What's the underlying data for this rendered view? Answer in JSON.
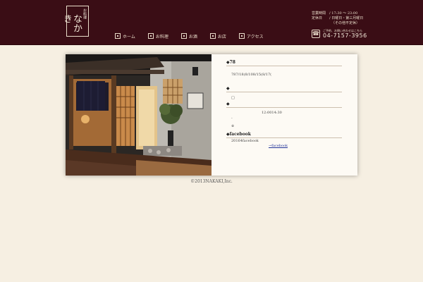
{
  "header": {
    "logo": {
      "main": "なかき",
      "sub": "お料理"
    },
    "nav": [
      {
        "label": "ホーム",
        "icon": "home-icon"
      },
      {
        "label": "お料理",
        "icon": "dish-icon"
      },
      {
        "label": "お酒",
        "icon": "sake-icon"
      },
      {
        "label": "お店",
        "icon": "shop-icon"
      },
      {
        "label": "アクセス",
        "icon": "map-icon"
      }
    ],
    "hours": {
      "line1": "営業時間　/ 17:30 〜 23:00",
      "line2": "定休日　　/ 日曜日・第三月曜日",
      "line3": "（その他不定休）"
    },
    "phone": {
      "note": "ご予約、お問い合わせはこちら",
      "number": "04-7157-3956",
      "icon": "phone-icon"
    }
  },
  "info": {
    "heading1": "◆78",
    "line1": "787/18(8/108/15(8/17(",
    "heading2": "◆",
    "line2": "□",
    "heading3": "◆",
    "line3": "12:0014:30",
    "line4": "-",
    "line5": "※",
    "heading4": "◆facebook",
    "line6": "20164facebook",
    "link": "→facebook"
  },
  "footer": {
    "copyright": "©2013NAKAKI,Inc."
  }
}
